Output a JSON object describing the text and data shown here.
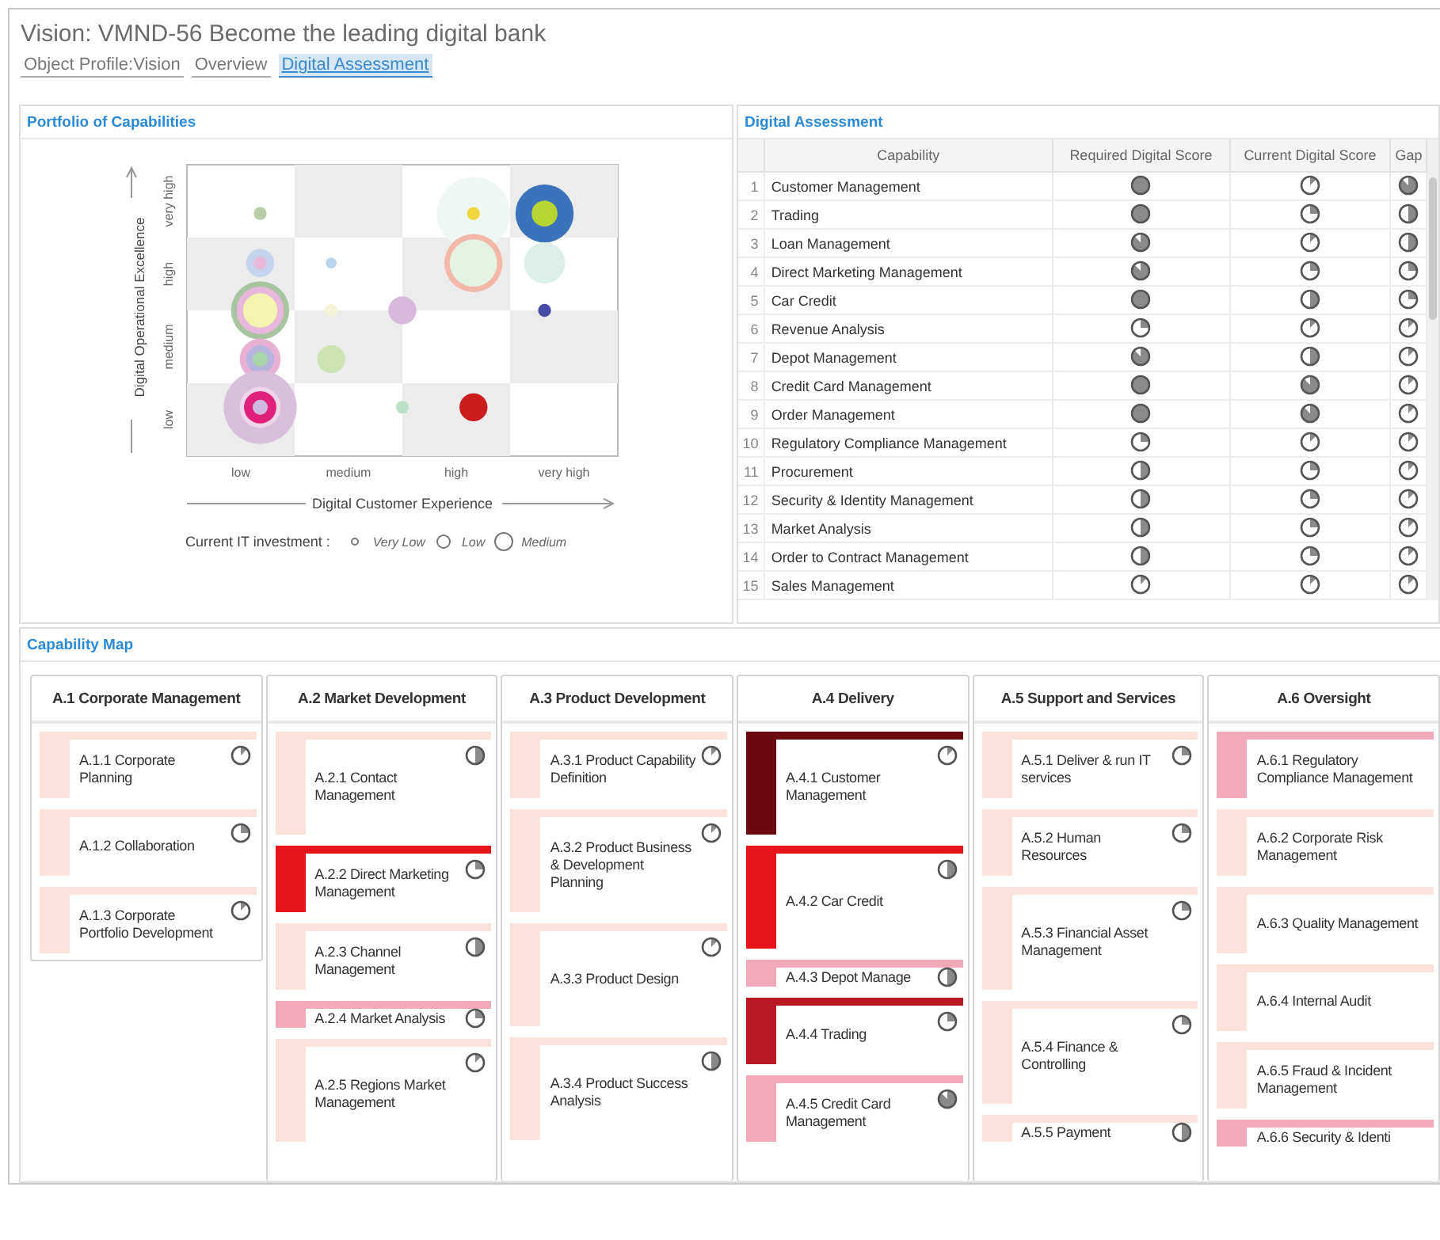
{
  "title": "Vision: VMND-56 Become the leading digital bank",
  "tabs": [
    {
      "label": "Object Profile:Vision",
      "selected": false
    },
    {
      "label": "Overview",
      "selected": false
    },
    {
      "label": "Digital Assessment",
      "selected": true
    }
  ],
  "portfolio": {
    "title": "Portfolio of Capabilities",
    "chart": {
      "xlabel": "Digital Customer Experience",
      "ylabel": "Digital Operational Excellence",
      "x_labels": [
        "low",
        "medium",
        "high",
        "very high"
      ],
      "y_labels": [
        "low",
        "medium",
        "high",
        "very high"
      ]
    },
    "legend": {
      "label": "Current IT investment :",
      "items": [
        "Very Low",
        "Low",
        "Medium"
      ]
    }
  },
  "assessment": {
    "title": "Digital Assessment",
    "columns": [
      "Capability",
      "Required Digital Score",
      "Current Digital Score",
      "Gap"
    ],
    "rows": [
      {
        "index": "1",
        "capability": "Customer Management",
        "required": {
          "kind": "full"
        },
        "current": {
          "kind": "eighth"
        },
        "gap": {
          "kind": "seven_eighths"
        }
      },
      {
        "index": "2",
        "capability": "Trading",
        "required": {
          "kind": "full"
        },
        "current": {
          "kind": "quarter"
        },
        "gap": {
          "kind": "half"
        }
      },
      {
        "index": "3",
        "capability": "Loan Management",
        "required": {
          "kind": "seven_eighths"
        },
        "current": {
          "kind": "eighth"
        },
        "gap": {
          "kind": "half"
        }
      },
      {
        "index": "4",
        "capability": "Direct Marketing Management",
        "required": {
          "kind": "seven_eighths"
        },
        "current": {
          "kind": "quarter"
        },
        "gap": {
          "kind": "quarter"
        }
      },
      {
        "index": "5",
        "capability": "Car Credit",
        "required": {
          "kind": "full"
        },
        "current": {
          "kind": "half"
        },
        "gap": {
          "kind": "quarter"
        }
      },
      {
        "index": "6",
        "capability": "Revenue Analysis",
        "required": {
          "kind": "quarter"
        },
        "current": {
          "kind": "eighth"
        },
        "gap": {
          "kind": "eighth"
        }
      },
      {
        "index": "7",
        "capability": "Depot Management",
        "required": {
          "kind": "seven_eighths"
        },
        "current": {
          "kind": "half"
        },
        "gap": {
          "kind": "eighth"
        }
      },
      {
        "index": "8",
        "capability": "Credit Card Management",
        "required": {
          "kind": "full"
        },
        "current": {
          "kind": "seven_eighths"
        },
        "gap": {
          "kind": "eighth"
        }
      },
      {
        "index": "9",
        "capability": "Order Management",
        "required": {
          "kind": "full"
        },
        "current": {
          "kind": "seven_eighths"
        },
        "gap": {
          "kind": "eighth"
        }
      },
      {
        "index": "10",
        "capability": "Regulatory Compliance Management",
        "required": {
          "kind": "quarter"
        },
        "current": {
          "kind": "eighth"
        },
        "gap": {
          "kind": "eighth"
        }
      },
      {
        "index": "11",
        "capability": "Procurement",
        "required": {
          "kind": "half"
        },
        "current": {
          "kind": "quarter"
        },
        "gap": {
          "kind": "eighth"
        }
      },
      {
        "index": "12",
        "capability": "Security & Identity Management",
        "required": {
          "kind": "half"
        },
        "current": {
          "kind": "quarter"
        },
        "gap": {
          "kind": "eighth"
        }
      },
      {
        "index": "13",
        "capability": "Market Analysis",
        "required": {
          "kind": "half"
        },
        "current": {
          "kind": "quarter"
        },
        "gap": {
          "kind": "eighth"
        }
      },
      {
        "index": "14",
        "capability": "Order to Contract Management",
        "required": {
          "kind": "half"
        },
        "current": {
          "kind": "quarter"
        },
        "gap": {
          "kind": "eighth"
        }
      },
      {
        "index": "15",
        "capability": "Sales Management",
        "required": {
          "kind": "eighth"
        },
        "current": {
          "kind": "eighth"
        },
        "gap": {
          "kind": "eighth"
        }
      }
    ]
  },
  "capability_map": {
    "title": "Capability Map",
    "columns": [
      {
        "title": "A.1 Corporate Management",
        "cards": [
          {
            "label": "A.1.1 Corporate Planning",
            "kind": "normal",
            "color": "#fce2da",
            "score": {
              "kind": "eighth"
            }
          },
          {
            "label": "A.1.2 Collaboration",
            "kind": "normal",
            "color": "#fce2da",
            "score": {
              "kind": "quarter"
            }
          },
          {
            "label": "A.1.3 Corporate Portfolio Development",
            "kind": "normal",
            "color": "#fce2da",
            "score": {
              "kind": "eighth"
            }
          }
        ]
      },
      {
        "title": "A.2 Market Development",
        "cards": [
          {
            "label": "A.2.1 Contact Management",
            "kind": "tall",
            "color": "#fce2da",
            "score": {
              "kind": "half"
            }
          },
          {
            "label": "A.2.2 Direct Marketing Management",
            "kind": "normal",
            "color": "#e8141c",
            "score": {
              "kind": "quarter"
            }
          },
          {
            "label": "A.2.3 Channel Management",
            "kind": "normal",
            "color": "#fce2da",
            "score": {
              "kind": "half"
            }
          },
          {
            "label": "A.2.4 Market Analysis",
            "kind": "short",
            "color": "#f2a8b8",
            "score": {
              "kind": "quarter"
            }
          },
          {
            "label": "A.2.5 Regions Market Management",
            "kind": "tall",
            "color": "#fce2da",
            "score": {
              "kind": "eighth"
            }
          }
        ]
      },
      {
        "title": "A.3 Product Development",
        "cards": [
          {
            "label": "A.3.1 Product Capability Definition",
            "kind": "normal",
            "color": "#fce2da",
            "score": {
              "kind": "eighth"
            }
          },
          {
            "label": "A.3.2 Product Business & Development Planning",
            "kind": "tall",
            "color": "#fce2da",
            "score": {
              "kind": "eighth"
            }
          },
          {
            "label": "A.3.3 Product Design",
            "kind": "tall",
            "color": "#fce2da",
            "score": {
              "kind": "eighth"
            }
          },
          {
            "label": "A.3.4 Product Success Analysis",
            "kind": "tall",
            "color": "#fce2da",
            "score": {
              "kind": "half"
            }
          }
        ]
      },
      {
        "title": "A.4 Delivery",
        "cards": [
          {
            "label": "A.4.1 Customer Management",
            "kind": "tall",
            "color": "#6a0a0e",
            "score": {
              "kind": "eighth"
            }
          },
          {
            "label": "A.4.2 Car Credit",
            "kind": "tall",
            "color": "#e8141c",
            "score": {
              "kind": "half"
            }
          },
          {
            "label": "A.4.3 Depot Manage",
            "kind": "short",
            "color": "#f2a8b8",
            "score": {
              "kind": "half"
            }
          },
          {
            "label": "A.4.4 Trading",
            "kind": "normal",
            "color": "#b81820",
            "score": {
              "kind": "quarter"
            }
          },
          {
            "label": "A.4.5 Credit Card Management",
            "kind": "normal",
            "color": "#f2a8b8",
            "score": {
              "kind": "seven_eighths"
            }
          }
        ]
      },
      {
        "title": "A.5 Support and Services",
        "cards": [
          {
            "label": "A.5.1 Deliver & run IT services",
            "kind": "normal",
            "color": "#fce2da",
            "score": {
              "kind": "quarter"
            }
          },
          {
            "label": "A.5.2 Human Resources",
            "kind": "normal",
            "color": "#fce2da",
            "score": {
              "kind": "quarter"
            }
          },
          {
            "label": "A.5.3 Financial Asset Management",
            "kind": "tall",
            "color": "#fce2da",
            "score": {
              "kind": "quarter"
            }
          },
          {
            "label": "A.5.4 Finance & Controlling",
            "kind": "tall",
            "color": "#fce2da",
            "score": {
              "kind": "quarter"
            }
          },
          {
            "label": "A.5.5 Payment",
            "kind": "short",
            "color": "#fce2da",
            "score": {
              "kind": "half"
            }
          }
        ]
      },
      {
        "title": "A.6 Oversight",
        "cards": [
          {
            "label": "A.6.1 Regulatory Compliance Management",
            "kind": "normal",
            "color": "#f2a8b8"
          },
          {
            "label": "A.6.2 Corporate Risk Management",
            "kind": "normal",
            "color": "#fce2da"
          },
          {
            "label": "A.6.3 Quality Management",
            "kind": "normal",
            "color": "#fce2da"
          },
          {
            "label": "A.6.4 Internal Audit",
            "kind": "normal",
            "color": "#fce2da"
          },
          {
            "label": "A.6.5 Fraud & Incident Management",
            "kind": "normal",
            "color": "#fce2da"
          },
          {
            "label": "A.6.6 Security & Identi",
            "kind": "short",
            "color": "#f2a8b8"
          }
        ]
      }
    ]
  }
}
